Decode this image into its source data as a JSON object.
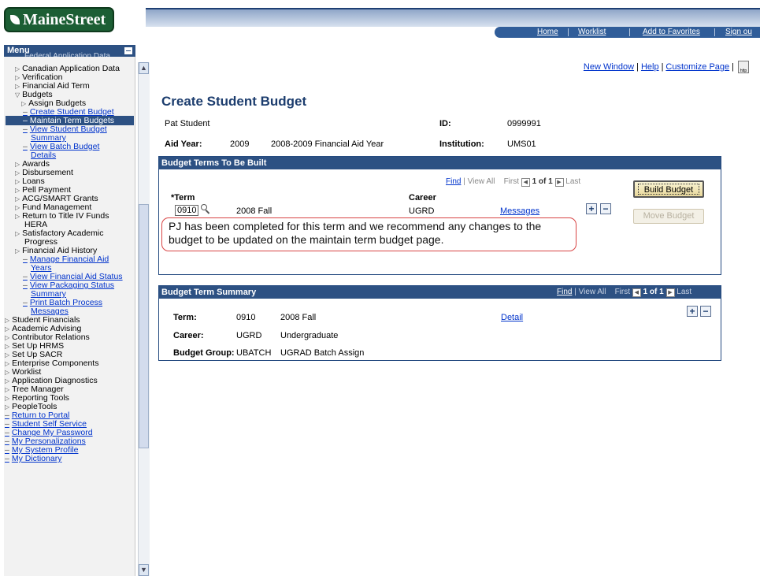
{
  "header": {
    "logo_text": "MaineStreet",
    "nav": [
      "Home",
      "Worklist",
      "Add to Favorites",
      "Sign ou"
    ]
  },
  "menu": {
    "title": "Menu",
    "partial_item": "Federal Application Data",
    "items": [
      {
        "label": "Canadian Application Data",
        "type": "folder"
      },
      {
        "label": "Verification",
        "type": "folder"
      },
      {
        "label": "Financial Aid Term",
        "type": "folder"
      },
      {
        "label": "Budgets",
        "type": "open-folder"
      },
      {
        "label": "Assign Budgets",
        "type": "folder"
      },
      {
        "label": "Create Student Budget",
        "type": "link"
      },
      {
        "label": "Maintain Term Budgets",
        "type": "selected"
      },
      {
        "label": "View Student Budget",
        "type": "link"
      },
      {
        "label": "Summary",
        "type": "link-cont"
      },
      {
        "label": "View Batch Budget",
        "type": "link"
      },
      {
        "label": "Details",
        "type": "link-cont"
      },
      {
        "label": "Awards",
        "type": "folder"
      },
      {
        "label": "Disbursement",
        "type": "folder"
      },
      {
        "label": "Loans",
        "type": "folder"
      },
      {
        "label": "Pell Payment",
        "type": "folder"
      },
      {
        "label": "ACG/SMART Grants",
        "type": "folder"
      },
      {
        "label": "Fund Management",
        "type": "folder"
      },
      {
        "label": "Return to Title IV Funds",
        "type": "folder"
      },
      {
        "label": "HERA",
        "type": "text-cont"
      },
      {
        "label": "Satisfactory Academic",
        "type": "folder"
      },
      {
        "label": "Progress",
        "type": "text-cont"
      },
      {
        "label": "Financial Aid History",
        "type": "folder"
      },
      {
        "label": "Manage Financial Aid",
        "type": "link"
      },
      {
        "label": "Years",
        "type": "link-cont"
      },
      {
        "label": "View Financial Aid Status",
        "type": "link"
      },
      {
        "label": "View Packaging Status",
        "type": "link"
      },
      {
        "label": "Summary",
        "type": "link-cont"
      },
      {
        "label": "Print Batch Process",
        "type": "link"
      },
      {
        "label": "Messages",
        "type": "link-cont"
      },
      {
        "label": "Student Financials",
        "type": "root-folder"
      },
      {
        "label": "Academic Advising",
        "type": "root-folder"
      },
      {
        "label": "Contributor Relations",
        "type": "root-folder"
      },
      {
        "label": "Set Up HRMS",
        "type": "root-folder"
      },
      {
        "label": "Set Up SACR",
        "type": "root-folder"
      },
      {
        "label": "Enterprise Components",
        "type": "root-folder"
      },
      {
        "label": "Worklist",
        "type": "root-folder"
      },
      {
        "label": "Application Diagnostics",
        "type": "root-folder"
      },
      {
        "label": "Tree Manager",
        "type": "root-folder"
      },
      {
        "label": "Reporting Tools",
        "type": "root-folder"
      },
      {
        "label": "PeopleTools",
        "type": "root-folder"
      },
      {
        "label": "Return to Portal",
        "type": "root-link"
      },
      {
        "label": "Student Self Service",
        "type": "root-link"
      },
      {
        "label": "Change My Password",
        "type": "root-link"
      },
      {
        "label": "My Personalizations",
        "type": "root-link"
      },
      {
        "label": "My System Profile",
        "type": "root-link"
      },
      {
        "label": "My Dictionary",
        "type": "root-link"
      }
    ]
  },
  "page_tools": {
    "new_window": "New Window",
    "help": "Help",
    "customize": "Customize Page",
    "http_icon_label": "http"
  },
  "page": {
    "title": "Create Student Budget",
    "student_name": "Pat Student",
    "id_label": "ID:",
    "id_value": "0999991",
    "aid_year_label": "Aid Year:",
    "aid_year_value": "2009",
    "aid_year_desc": "2008-2009 Financial Aid Year",
    "institution_label": "Institution:",
    "institution_value": "UMS01"
  },
  "terms_box": {
    "title": "Budget Terms To Be Built",
    "find": "Find",
    "view_all": "View All",
    "first": "First",
    "count": "1 of 1",
    "last": "Last",
    "term_header": "*Term",
    "career_header": "Career",
    "term_value": "0910",
    "term_desc": "2008 Fall",
    "career_value": "UGRD",
    "messages_link": "Messages",
    "build_button": "Build Budget",
    "move_button": "Move Budget"
  },
  "callout_text": "PJ has been completed for this term and we recommend any changes to the budget to be updated on the maintain term budget page.",
  "summary_box": {
    "title": "Budget Term Summary",
    "find": "Find",
    "view_all": "View All",
    "first": "First",
    "count": "1 of 1",
    "last": "Last",
    "term_label": "Term:",
    "term_value": "0910",
    "term_desc": "2008 Fall",
    "career_label": "Career:",
    "career_value": "UGRD",
    "career_desc": "Undergraduate",
    "group_label": "Budget Group:",
    "group_value": "UBATCH",
    "group_desc": "UGRAD Batch Assign",
    "detail_link": "Detail"
  }
}
